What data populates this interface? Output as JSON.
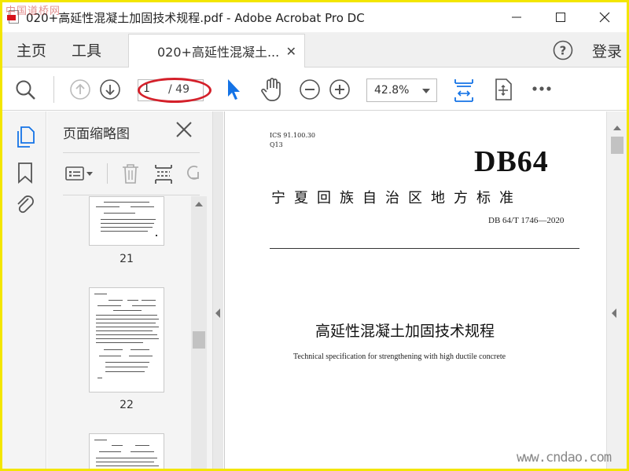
{
  "window": {
    "title": "020+高延性混凝土加固技术规程.pdf - Adobe Acrobat Pro DC",
    "watermark_top": "中国道桥网",
    "watermark_bottom": "www.cndao.com"
  },
  "menu": {
    "home": "主页",
    "tools": "工具",
    "doc_tab": "020+高延性混凝土...",
    "login": "登录"
  },
  "toolbar": {
    "current_page": "1",
    "total_pages": "/ 49",
    "zoom": "42.8%"
  },
  "thumbnails": {
    "title": "页面缩略图",
    "pages": [
      {
        "number": "21"
      },
      {
        "number": "22"
      }
    ]
  },
  "document": {
    "ics": "ICS 91.100.30",
    "ccs": "Q13",
    "standard_prefix": "DB64",
    "region": "宁夏回族自治区地方标准",
    "code": "DB 64/T  1746—2020",
    "title": "高延性混凝土加固技术规程",
    "subtitle_en": "Technical specification for strengthening with high ductile concrete"
  },
  "colors": {
    "accent_blue": "#1473e6",
    "annotation_red": "#d4202a",
    "frame_yellow": "#f3e600"
  }
}
